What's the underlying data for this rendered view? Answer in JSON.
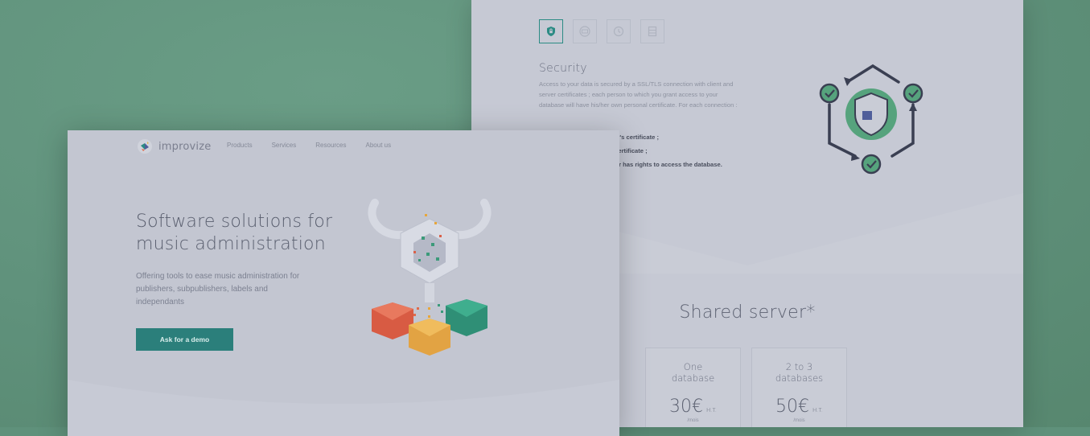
{
  "colors": {
    "background": "#5f917b",
    "accent": "#2b7f7b",
    "panel": "#c6c9d4"
  },
  "security_page": {
    "tabs": [
      {
        "name": "shield-icon",
        "active": true
      },
      {
        "name": "server-icon",
        "active": false
      },
      {
        "name": "history-icon",
        "active": false
      },
      {
        "name": "database-icon",
        "active": false
      }
    ],
    "title": "Security",
    "text": "Access to your data is secured by a SSL/TLS connection with client and server certificates ; each person to which you grant access to your database will have his/her own personal certificate. For each connection :",
    "list": [
      "rver's certificate ;",
      "'s certificate ;",
      "user has rights to access the database."
    ]
  },
  "pricing": {
    "title": "Shared server*",
    "cards": [
      {
        "name": "One\ndatabase",
        "price": "30€",
        "tax": "H.T.",
        "unit": "/mois"
      },
      {
        "name": "2 to 3\ndatabases",
        "price": "50€",
        "tax": "H.T.",
        "unit": "/mois"
      }
    ]
  },
  "homepage": {
    "brand": "improvize",
    "nav": [
      "Products",
      "Services",
      "Resources",
      "About us"
    ],
    "hero_title_line1": "Software solutions for",
    "hero_title_line2": "music administration",
    "hero_sub": "Offering tools to ease music administration for publishers, subpublishers, labels and independants",
    "cta": "Ask for a demo"
  }
}
